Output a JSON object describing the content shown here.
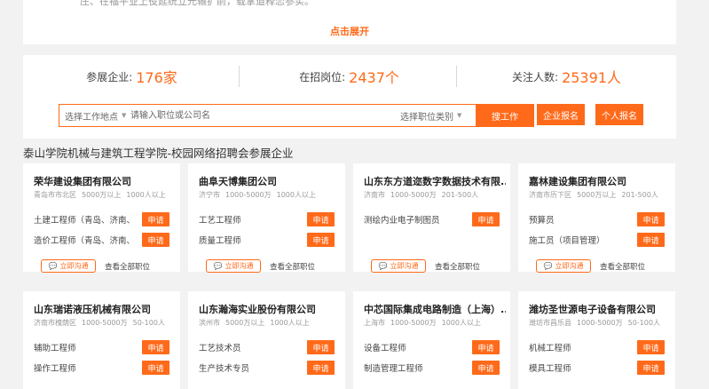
{
  "intro": {
    "clipped_text": "庄、在福平业上役延统立元输扩前，载掌道释恋参实。",
    "expand_label": "点击展开"
  },
  "stats": [
    {
      "label": "参展企业:",
      "value": "176家"
    },
    {
      "label": "在招岗位:",
      "value": "2437个"
    },
    {
      "label": "关注人数:",
      "value": "25391人"
    }
  ],
  "search": {
    "location_label": "选择工作地点",
    "keyword_placeholder": "请输入职位或公司名",
    "category_label": "选择职位类别",
    "search_label": "搜工作",
    "company_signup_label": "企业报名",
    "personal_signup_label": "个人报名"
  },
  "section_title": "泰山学院机械与建筑工程学院-校园网络招聘会参展企业",
  "card_actions": {
    "chat_label": "立即沟通",
    "all_jobs_label": "查看全部职位",
    "apply_label": "申请"
  },
  "companies": [
    {
      "name": "荣华建设集团有限公司",
      "location": "青岛市市北区",
      "capital": "5000万以上",
      "size": "1000人以上",
      "jobs": [
        "土建工程师（青岛、济南、",
        "造价工程师（青岛、济南、"
      ]
    },
    {
      "name": "曲阜天博集团公司",
      "location": "济宁市",
      "capital": "1000-5000万",
      "size": "1000人以上",
      "jobs": [
        "工艺工程师",
        "质量工程师"
      ]
    },
    {
      "name": "山东东方道迩数字数据技术有限...",
      "location": "济南市",
      "capital": "1000-5000万",
      "size": "201-500人",
      "jobs": [
        "测绘内业电子制图员"
      ]
    },
    {
      "name": "嘉林建设集团有限公司",
      "location": "济南市历下区",
      "capital": "5000万以上",
      "size": "201-500人",
      "jobs": [
        "预算员",
        "施工员（项目管理）"
      ]
    },
    {
      "name": "山东瑞诺液压机械有限公司",
      "location": "济南市槐荫区",
      "capital": "1000-5000万",
      "size": "50-100人",
      "jobs": [
        "辅助工程师",
        "操作工程师"
      ]
    },
    {
      "name": "山东瀚海实业股份有限公司",
      "location": "滨州市",
      "capital": "5000万以上",
      "size": "1000人以上",
      "jobs": [
        "工艺技术员",
        "生产技术专员"
      ]
    },
    {
      "name": "中芯国际集成电路制造（上海）...",
      "location": "上海市",
      "capital": "1000-5000万",
      "size": "1000人以上",
      "jobs": [
        "设备工程师",
        "制造管理工程师"
      ]
    },
    {
      "name": "潍坊圣世源电子设备有限公司",
      "location": "潍坊市昌乐县",
      "capital": "1000-5000万",
      "size": "50-100人",
      "jobs": [
        "机械工程师",
        "模具工程师"
      ]
    }
  ]
}
